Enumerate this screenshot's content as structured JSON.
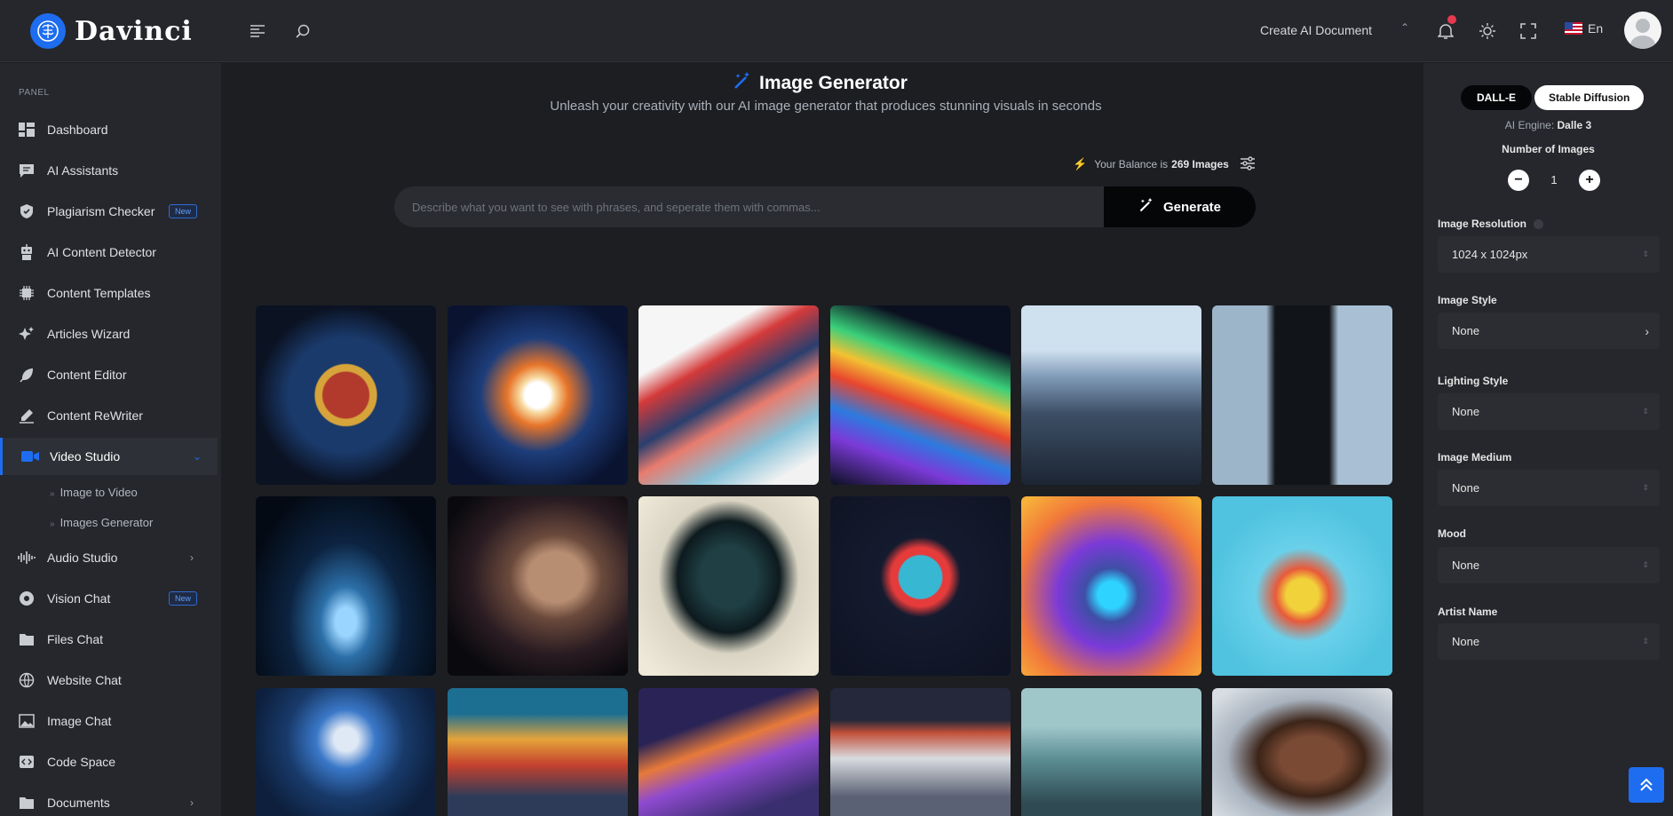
{
  "app": {
    "name": "Davinci"
  },
  "header": {
    "create_document": "Create AI Document",
    "language": "En"
  },
  "sidebar": {
    "panel_label": "PANEL",
    "items": [
      {
        "label": "Dashboard",
        "icon": "dashboard-icon"
      },
      {
        "label": "AI Assistants",
        "icon": "chat-icon"
      },
      {
        "label": "Plagiarism Checker",
        "icon": "shield-icon",
        "badge": "New"
      },
      {
        "label": "AI Content Detector",
        "icon": "robot-icon"
      },
      {
        "label": "Content Templates",
        "icon": "chip-icon"
      },
      {
        "label": "Articles Wizard",
        "icon": "sparkle-icon"
      },
      {
        "label": "Content Editor",
        "icon": "feather-icon"
      },
      {
        "label": "Content ReWriter",
        "icon": "pen-icon"
      },
      {
        "label": "Video Studio",
        "icon": "video-icon"
      },
      {
        "label": "Audio Studio",
        "icon": "audio-icon"
      },
      {
        "label": "Vision Chat",
        "icon": "vision-icon",
        "badge": "New"
      },
      {
        "label": "Files Chat",
        "icon": "folder-icon"
      },
      {
        "label": "Website Chat",
        "icon": "globe-icon"
      },
      {
        "label": "Image Chat",
        "icon": "image-icon"
      },
      {
        "label": "Code Space",
        "icon": "code-icon"
      },
      {
        "label": "Documents",
        "icon": "documents-icon"
      }
    ],
    "sub_items": [
      "Image to Video",
      "Images Generator"
    ]
  },
  "main": {
    "title": "Image Generator",
    "subtitle": "Unleash your creativity with our AI image generator that produces stunning visuals in seconds",
    "balance_prefix": "Your Balance is",
    "balance_value": "269 Images",
    "prompt_placeholder": "Describe what you want to see with phrases, and seperate them with commas...",
    "generate_label": "Generate"
  },
  "right_panel": {
    "engine_tabs": [
      "DALL-E",
      "Stable Diffusion"
    ],
    "engine_prefix": "AI Engine:",
    "engine_value": "Dalle 3",
    "number_label": "Number of Images",
    "number_value": "1",
    "fields": [
      {
        "label": "Image Resolution",
        "value": "1024 x 1024px"
      },
      {
        "label": "Image Style",
        "value": "None"
      },
      {
        "label": "Lighting Style",
        "value": "None"
      },
      {
        "label": "Image Medium",
        "value": "None"
      },
      {
        "label": "Mood",
        "value": "None"
      },
      {
        "label": "Artist Name",
        "value": "None"
      }
    ]
  },
  "colors": {
    "accent": "#1e6df0",
    "background": "#1c1e22",
    "panel": "#25272c",
    "notification": "#e53950"
  }
}
